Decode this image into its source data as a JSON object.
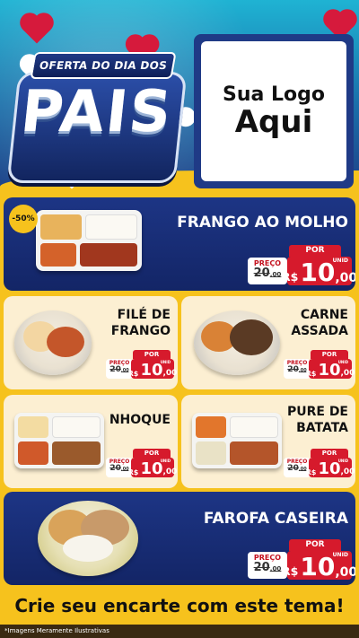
{
  "header": {
    "banner_top": "OFERTA DO DIA DOS",
    "banner_word": "PAIS",
    "logo_line1": "Sua Logo",
    "logo_line2": "Aqui"
  },
  "price_labels": {
    "por": "POR",
    "preco": "PREÇO",
    "currency": "R$",
    "unit": "UNID"
  },
  "items": [
    {
      "name": "FRANGO AO MOLHO",
      "old_price_int": "20",
      "old_price_dec": "00",
      "price_int": "10",
      "price_dec": "00",
      "discount": "-50%"
    },
    {
      "name_line1": "FILÉ DE",
      "name_line2": "FRANGO",
      "old_price_int": "20",
      "old_price_dec": "00",
      "price_int": "10",
      "price_dec": "00"
    },
    {
      "name_line1": "CARNE",
      "name_line2": "ASSADA",
      "old_price_int": "20",
      "old_price_dec": "00",
      "price_int": "10",
      "price_dec": "00"
    },
    {
      "name": "NHOQUE",
      "old_price_int": "20",
      "old_price_dec": "00",
      "price_int": "10",
      "price_dec": "00"
    },
    {
      "name_line1": "PURE DE",
      "name_line2": "BATATA",
      "old_price_int": "20",
      "old_price_dec": "00",
      "price_int": "10",
      "price_dec": "00"
    },
    {
      "name": "FAROFA CASEIRA",
      "old_price_int": "20",
      "old_price_dec": "00",
      "price_int": "10",
      "price_dec": "00"
    }
  ],
  "footer": {
    "cta": "Crie seu encarte com este tema!",
    "note": "*Imagens Meramente Ilustrativas"
  },
  "colors": {
    "navy": "#1d3585",
    "cream": "#fcefd2",
    "yellow": "#f6c21d",
    "red": "#d61a2c"
  }
}
